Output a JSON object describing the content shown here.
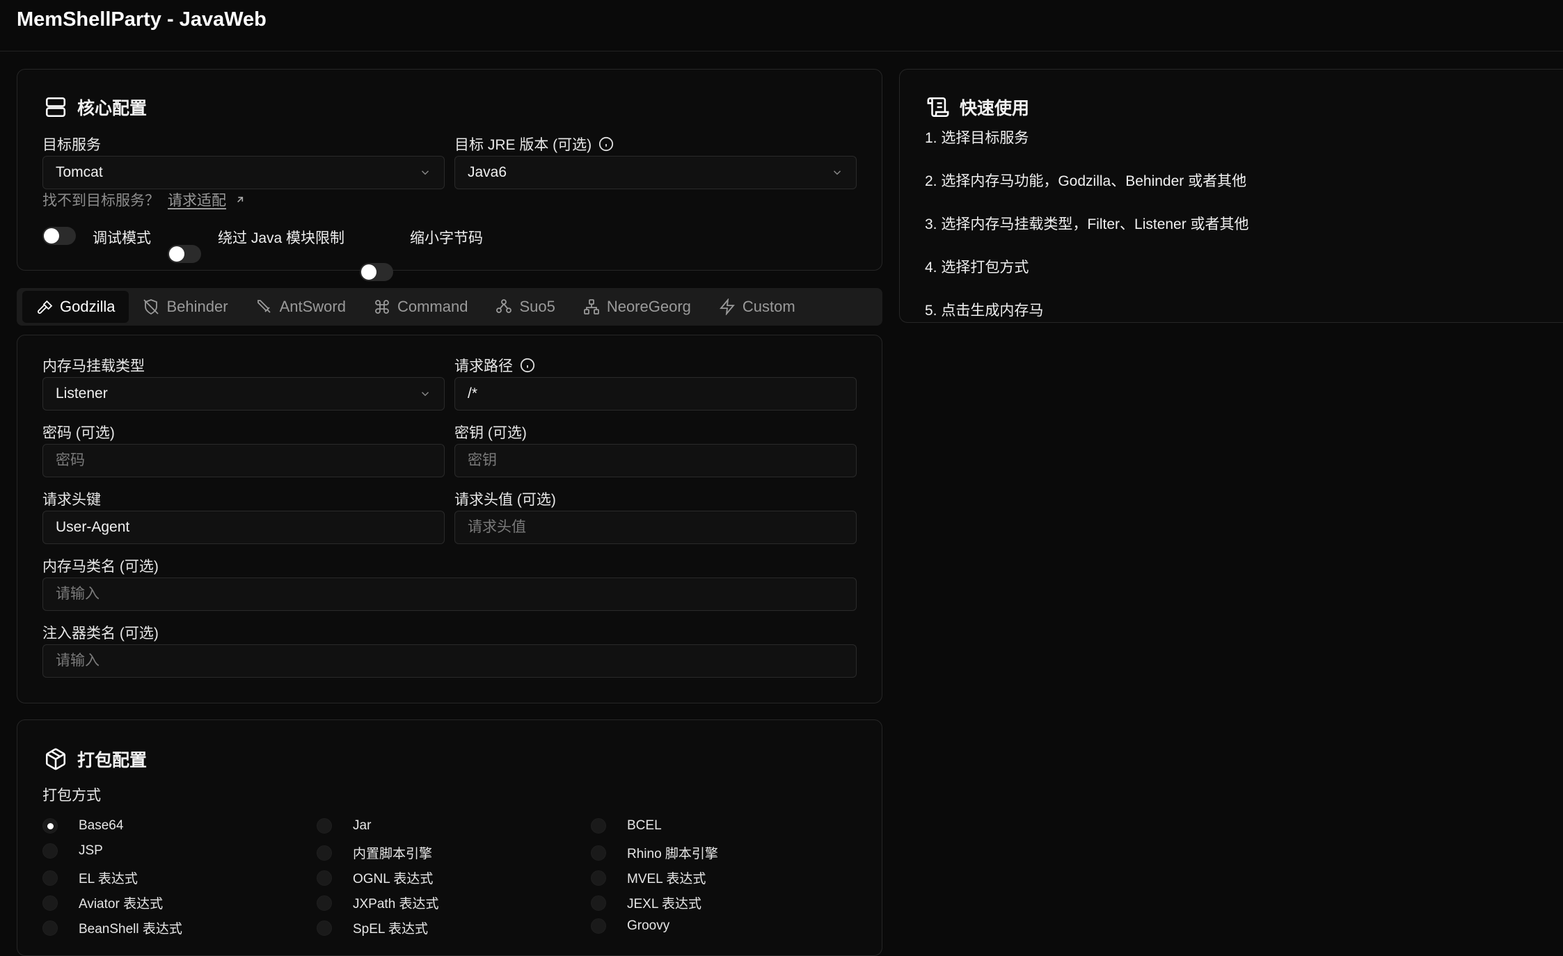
{
  "app": {
    "title": "MemShellParty - JavaWeb"
  },
  "core": {
    "title": "核心配置",
    "server_label": "目标服务",
    "server_value": "Tomcat",
    "jre_label": "目标 JRE 版本 (可选)",
    "jre_value": "Java6",
    "hint_text": "找不到目标服务？",
    "hint_link": "请求适配",
    "toggles": [
      {
        "label": "调试模式",
        "on": false
      },
      {
        "label": "绕过 Java 模块限制",
        "on": false
      },
      {
        "label": "缩小字节码",
        "on": false
      }
    ]
  },
  "tabs": [
    {
      "label": "Godzilla",
      "icon": "hammer-icon",
      "active": true
    },
    {
      "label": "Behinder",
      "icon": "shield-off-icon",
      "active": false
    },
    {
      "label": "AntSword",
      "icon": "sword-icon",
      "active": false
    },
    {
      "label": "Command",
      "icon": "command-icon",
      "active": false
    },
    {
      "label": "Suo5",
      "icon": "network-icon",
      "active": false
    },
    {
      "label": "NeoreGeorg",
      "icon": "tree-icon",
      "active": false
    },
    {
      "label": "Custom",
      "icon": "bolt-icon",
      "active": false
    }
  ],
  "shell": {
    "type_label": "内存马挂载类型",
    "type_value": "Listener",
    "path_label": "请求路径",
    "path_value": "/*",
    "password_label": "密码 (可选)",
    "password_placeholder": "密码",
    "key_label": "密钥 (可选)",
    "key_placeholder": "密钥",
    "header_key_label": "请求头键",
    "header_key_value": "User-Agent",
    "header_value_label": "请求头值 (可选)",
    "header_value_placeholder": "请求头值",
    "class_label": "内存马类名 (可选)",
    "class_placeholder": "请输入",
    "injector_label": "注入器类名 (可选)",
    "injector_placeholder": "请输入"
  },
  "packer": {
    "title": "打包配置",
    "method_label": "打包方式",
    "options": [
      {
        "label": "Base64",
        "checked": true
      },
      {
        "label": "Jar",
        "checked": false
      },
      {
        "label": "BCEL",
        "checked": false
      },
      {
        "label": "JSP",
        "checked": false
      },
      {
        "label": "内置脚本引擎",
        "checked": false
      },
      {
        "label": "Rhino 脚本引擎",
        "checked": false
      },
      {
        "label": "EL 表达式",
        "checked": false
      },
      {
        "label": "OGNL 表达式",
        "checked": false
      },
      {
        "label": "MVEL 表达式",
        "checked": false
      },
      {
        "label": "Aviator 表达式",
        "checked": false
      },
      {
        "label": "JXPath 表达式",
        "checked": false
      },
      {
        "label": "JEXL 表达式",
        "checked": false
      },
      {
        "label": "BeanShell 表达式",
        "checked": false
      },
      {
        "label": "SpEL 表达式",
        "checked": false
      },
      {
        "label": "Groovy",
        "checked": false
      }
    ]
  },
  "quick": {
    "title": "快速使用",
    "steps": [
      "1. 选择目标服务",
      "2. 选择内存马功能，Godzilla、Behinder 或者其他",
      "3. 选择内存马挂载类型，Filter、Listener 或者其他",
      "4. 选择打包方式",
      "5. 点击生成内存马"
    ]
  }
}
